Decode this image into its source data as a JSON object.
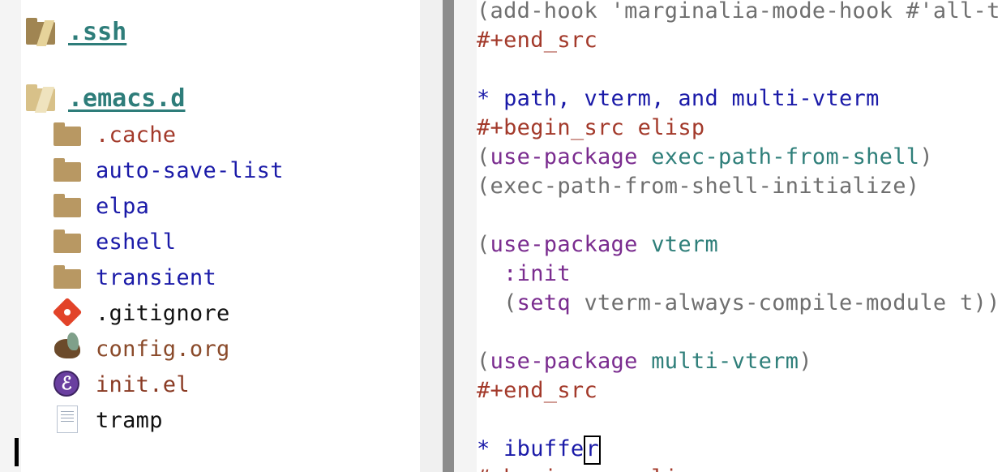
{
  "tree": {
    "roots": [
      {
        "name": ".ssh",
        "icon": "folder-icon"
      },
      {
        "name": ".emacs.d",
        "icon": "folder-open-icon"
      }
    ],
    "children": [
      {
        "name": ".cache",
        "icon": "folder-icon",
        "color": "#a33a2b"
      },
      {
        "name": "auto-save-list",
        "icon": "folder-icon",
        "color": "#1a1aa8"
      },
      {
        "name": "elpa",
        "icon": "folder-icon",
        "color": "#1a1aa8"
      },
      {
        "name": "eshell",
        "icon": "folder-icon",
        "color": "#1a1aa8"
      },
      {
        "name": "transient",
        "icon": "folder-icon",
        "color": "#1a1aa8"
      },
      {
        "name": ".gitignore",
        "icon": "git-icon",
        "color": "#111111"
      },
      {
        "name": "config.org",
        "icon": "org-unicorn-icon",
        "color": "#8a4a2a"
      },
      {
        "name": "init.el",
        "icon": "emacs-icon",
        "color": "#8a3b24"
      },
      {
        "name": "tramp",
        "icon": "text-file-icon",
        "color": "#111111"
      }
    ]
  },
  "editor": {
    "lines": [
      {
        "segments": [
          {
            "t": "(add-hook 'marginalia-mode-hook #'all-the",
            "c": "gray"
          }
        ]
      },
      {
        "segments": [
          {
            "t": "#+end_src",
            "c": "red"
          }
        ]
      },
      {
        "segments": []
      },
      {
        "segments": [
          {
            "t": "* path, vterm, and multi-vterm",
            "c": "blue"
          }
        ]
      },
      {
        "segments": [
          {
            "t": "#+begin_src elisp",
            "c": "red"
          }
        ]
      },
      {
        "segments": [
          {
            "t": "(",
            "c": "gray"
          },
          {
            "t": "use-package",
            "c": "purple"
          },
          {
            "t": " ",
            "c": "gray"
          },
          {
            "t": "exec-path-from-shell",
            "c": "teal"
          },
          {
            "t": ")",
            "c": "gray"
          }
        ]
      },
      {
        "segments": [
          {
            "t": "(exec-path-from-shell-initialize)",
            "c": "gray"
          }
        ]
      },
      {
        "segments": []
      },
      {
        "segments": [
          {
            "t": "(",
            "c": "gray"
          },
          {
            "t": "use-package",
            "c": "purple"
          },
          {
            "t": " ",
            "c": "gray"
          },
          {
            "t": "vterm",
            "c": "teal"
          }
        ]
      },
      {
        "segments": [
          {
            "t": "  ",
            "c": "gray"
          },
          {
            "t": ":init",
            "c": "purple"
          }
        ]
      },
      {
        "segments": [
          {
            "t": "  (",
            "c": "gray"
          },
          {
            "t": "setq",
            "c": "purple"
          },
          {
            "t": " vterm-always-compile-module t))",
            "c": "gray"
          }
        ]
      },
      {
        "segments": []
      },
      {
        "segments": [
          {
            "t": "(",
            "c": "gray"
          },
          {
            "t": "use-package",
            "c": "purple"
          },
          {
            "t": " ",
            "c": "gray"
          },
          {
            "t": "multi-vterm",
            "c": "teal"
          },
          {
            "t": ")",
            "c": "gray"
          }
        ]
      },
      {
        "segments": [
          {
            "t": "#+end_src",
            "c": "red"
          }
        ]
      },
      {
        "segments": []
      },
      {
        "segments": [
          {
            "t": "* ibuffe",
            "c": "blue"
          },
          {
            "t": "r",
            "c": "blue",
            "cursor": true
          }
        ]
      },
      {
        "segments": [
          {
            "t": "#+begin_src elisp",
            "c": "red"
          }
        ]
      }
    ]
  }
}
